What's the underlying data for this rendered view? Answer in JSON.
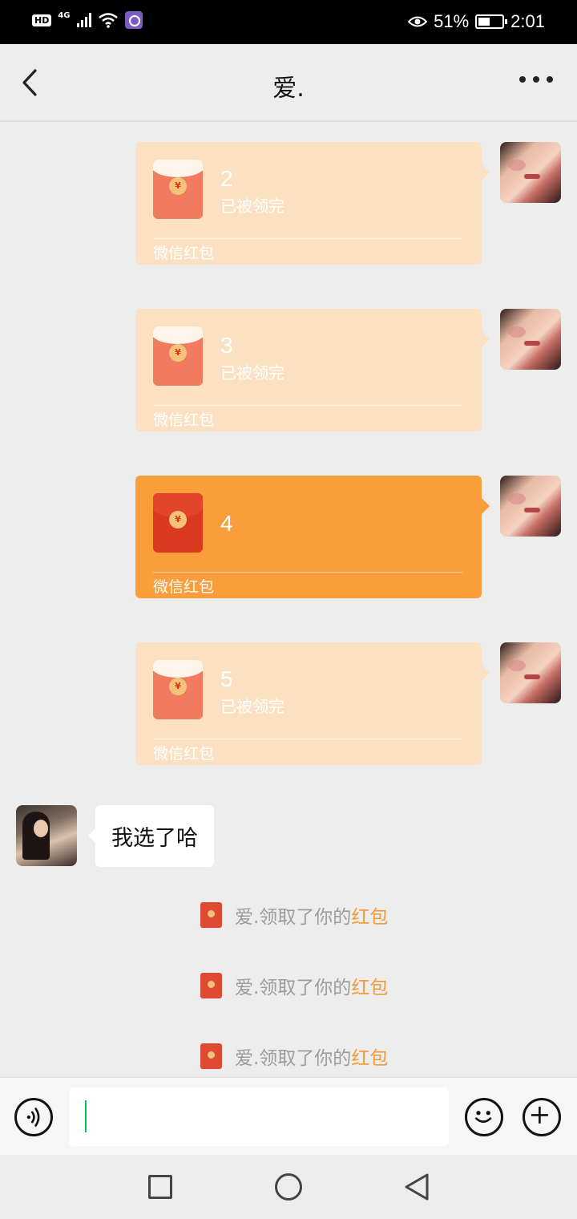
{
  "status_bar": {
    "hd": "HD",
    "network": "4G",
    "battery_percent": "51%",
    "battery_level": 0.51,
    "time": "2:01"
  },
  "header": {
    "title": "爱."
  },
  "red_packets": [
    {
      "number": "2",
      "status": "已被领完",
      "label": "微信红包",
      "state": "opened"
    },
    {
      "number": "3",
      "status": "已被领完",
      "label": "微信红包",
      "state": "opened"
    },
    {
      "number": "4",
      "status": "",
      "label": "微信红包",
      "state": "active"
    },
    {
      "number": "5",
      "status": "已被领完",
      "label": "微信红包",
      "state": "opened"
    }
  ],
  "incoming_message": {
    "text": "我选了哈"
  },
  "system_notices": [
    {
      "text": "爱.领取了你的",
      "link": "红包"
    },
    {
      "text": "爱.领取了你的",
      "link": "红包"
    },
    {
      "text": "爱.领取了你的",
      "link": "红包"
    }
  ],
  "input_bar": {
    "value": "",
    "placeholder": ""
  },
  "colors": {
    "opened_packet": "#fbe1c2",
    "active_packet": "#fa9d3b",
    "link": "#f09a3c",
    "caret": "#07c160"
  }
}
